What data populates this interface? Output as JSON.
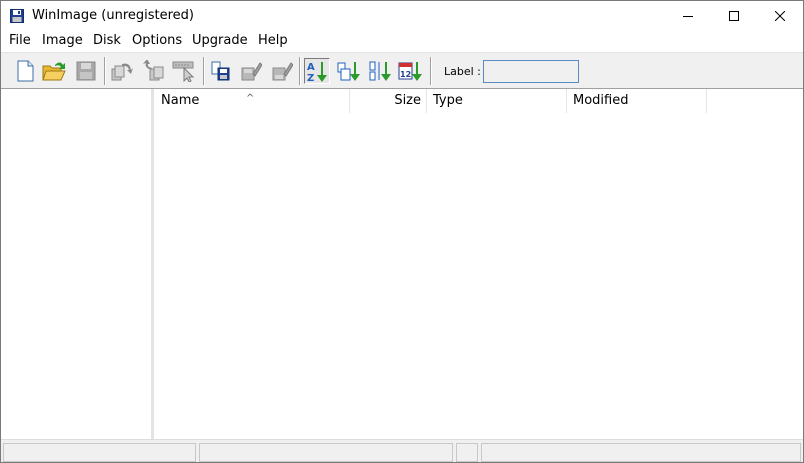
{
  "window": {
    "title": "WinImage (unregistered)"
  },
  "menu": [
    "File",
    "Image",
    "Disk",
    "Options",
    "Upgrade",
    "Help"
  ],
  "toolbar": {
    "label_caption": "Label :",
    "label_value": ""
  },
  "list": {
    "columns": [
      "Name",
      "Size",
      "Type",
      "Modified"
    ],
    "sort_indicator": "^"
  },
  "colors": {
    "accent_blue": "#1f5fbf",
    "sort_green": "#2a9a2a",
    "folder_yellow": "#f0c030",
    "disabled_gray": "#9a9a9a"
  }
}
